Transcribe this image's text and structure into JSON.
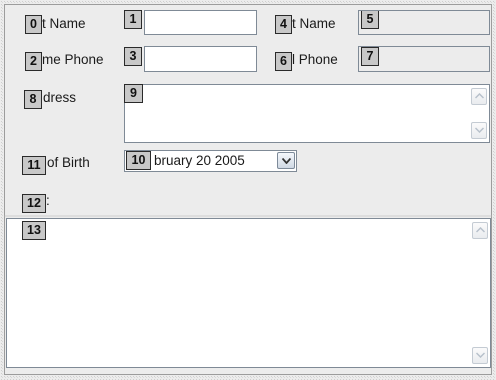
{
  "form": {
    "first_name_label": "t Name",
    "last_name_label": "t Name",
    "home_phone_label": "me Phone",
    "cell_phone_label": "l Phone",
    "address_label": "dress",
    "dob_label": "of Birth",
    "notes_label": ":",
    "first_name_value": "",
    "last_name_value": "",
    "home_phone_value": "",
    "cell_phone_value": "",
    "address_value": "",
    "dob_value": "bruary  20 2005",
    "notes_value": ""
  },
  "tags": [
    "0",
    "1",
    "2",
    "3",
    "4",
    "5",
    "6",
    "7",
    "8",
    "9",
    "10",
    "11",
    "12",
    "13"
  ],
  "icons": {
    "scroll_up": "scroll-up-arrow-icon",
    "scroll_down": "scroll-down-arrow-icon",
    "dropdown": "chevron-down-icon"
  }
}
